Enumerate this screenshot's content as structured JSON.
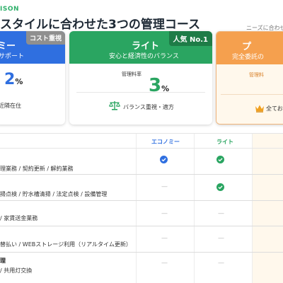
{
  "header": {
    "eyebrow": "ISON",
    "heading": "スタイルに合わせた3つの管理コース",
    "note": "ニーズに合わせて"
  },
  "cards": {
    "economy": {
      "name": "ミー",
      "badge": "コスト重視",
      "subtitle": "サポート",
      "rate_value": "2",
      "rate_unit": "%",
      "feature": "近隣在住",
      "color": "#2f6fe0"
    },
    "light": {
      "name": "ライト",
      "badge": "人気 No.1",
      "subtitle": "安心と経済性のバランス",
      "rate_label": "管理料率",
      "rate_value": "3",
      "rate_unit": "%",
      "feature": "バランス重視・適方",
      "feature_icon": "scale-icon",
      "color": "#2aa561"
    },
    "premium": {
      "name": "プ",
      "subtitle": "完全委託の",
      "rate_label": "管理料",
      "feature": "全ておす",
      "feature_icon": "crown-icon",
      "color": "#f5a04e"
    }
  },
  "table": {
    "columns": {
      "economy": "エコノミー",
      "light": "ライト"
    },
    "rows": [
      {
        "label": "理業務 / 契約更新 / 解約業務",
        "economy": "check-blue",
        "light": "check-green"
      },
      {
        "label": "掃点検 / 貯水槽清掃 / 法定点検 / 設備管理",
        "economy": "none",
        "light": "check-green"
      },
      {
        "label": "/ 家賃送金業務",
        "economy": "none",
        "light": "none"
      },
      {
        "label": "替払い / WEBストレージ利用（リアルタイム更新）",
        "economy": "none",
        "light": "none"
      },
      {
        "label_bold": "理",
        "label": "/ 共用灯交換",
        "economy": "none",
        "light": "none"
      }
    ]
  }
}
